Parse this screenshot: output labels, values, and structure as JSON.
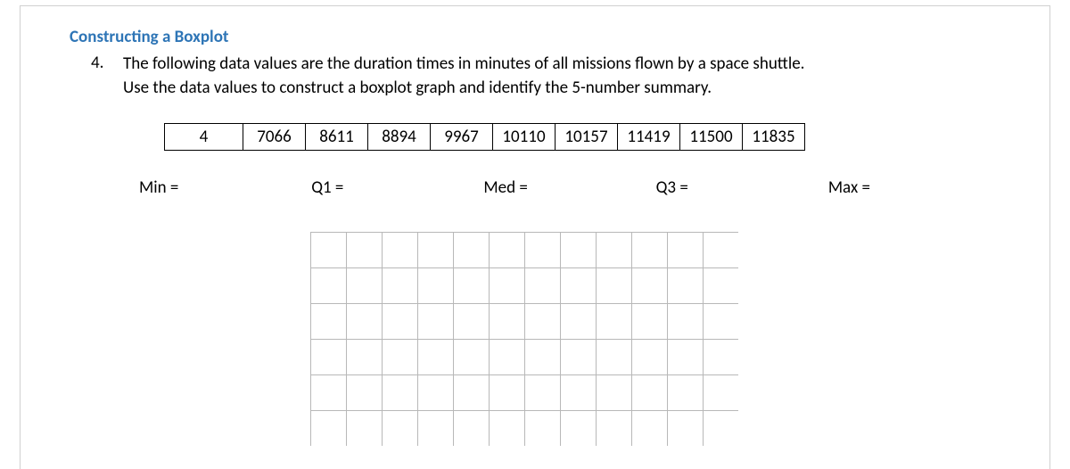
{
  "heading": "Constructing a Boxplot",
  "question": {
    "number": "4.",
    "text_line1": "The following data values are the duration times in minutes of all missions flown by a space shuttle.",
    "text_line2": "Use the data values to construct a boxplot graph and identify the 5-number summary."
  },
  "data_values": [
    "4",
    "7066",
    "8611",
    "8894",
    "9967",
    "10110",
    "10157",
    "11419",
    "11500",
    "11835"
  ],
  "summary": {
    "min": "Min =",
    "q1": "Q1 =",
    "med": "Med =",
    "q3": "Q3 =",
    "max": "Max ="
  },
  "grid": {
    "cols": 12,
    "rows": 6,
    "cell": 40
  }
}
